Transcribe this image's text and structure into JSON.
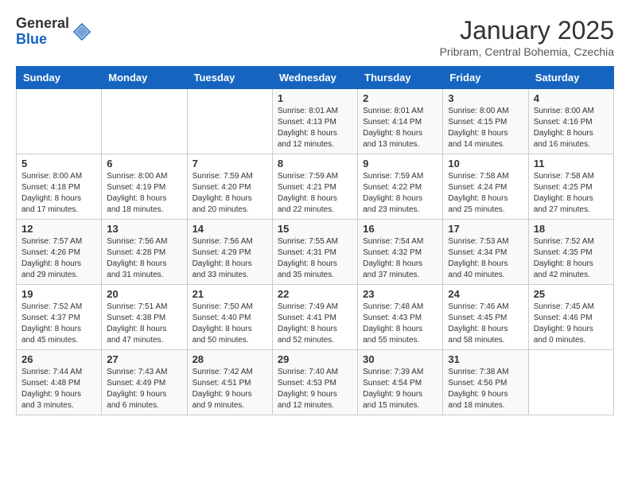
{
  "header": {
    "logo_general": "General",
    "logo_blue": "Blue",
    "month_title": "January 2025",
    "subtitle": "Pribram, Central Bohemia, Czechia"
  },
  "days_of_week": [
    "Sunday",
    "Monday",
    "Tuesday",
    "Wednesday",
    "Thursday",
    "Friday",
    "Saturday"
  ],
  "weeks": [
    [
      {
        "day": "",
        "info": ""
      },
      {
        "day": "",
        "info": ""
      },
      {
        "day": "",
        "info": ""
      },
      {
        "day": "1",
        "info": "Sunrise: 8:01 AM\nSunset: 4:13 PM\nDaylight: 8 hours\nand 12 minutes."
      },
      {
        "day": "2",
        "info": "Sunrise: 8:01 AM\nSunset: 4:14 PM\nDaylight: 8 hours\nand 13 minutes."
      },
      {
        "day": "3",
        "info": "Sunrise: 8:00 AM\nSunset: 4:15 PM\nDaylight: 8 hours\nand 14 minutes."
      },
      {
        "day": "4",
        "info": "Sunrise: 8:00 AM\nSunset: 4:16 PM\nDaylight: 8 hours\nand 16 minutes."
      }
    ],
    [
      {
        "day": "5",
        "info": "Sunrise: 8:00 AM\nSunset: 4:18 PM\nDaylight: 8 hours\nand 17 minutes."
      },
      {
        "day": "6",
        "info": "Sunrise: 8:00 AM\nSunset: 4:19 PM\nDaylight: 8 hours\nand 18 minutes."
      },
      {
        "day": "7",
        "info": "Sunrise: 7:59 AM\nSunset: 4:20 PM\nDaylight: 8 hours\nand 20 minutes."
      },
      {
        "day": "8",
        "info": "Sunrise: 7:59 AM\nSunset: 4:21 PM\nDaylight: 8 hours\nand 22 minutes."
      },
      {
        "day": "9",
        "info": "Sunrise: 7:59 AM\nSunset: 4:22 PM\nDaylight: 8 hours\nand 23 minutes."
      },
      {
        "day": "10",
        "info": "Sunrise: 7:58 AM\nSunset: 4:24 PM\nDaylight: 8 hours\nand 25 minutes."
      },
      {
        "day": "11",
        "info": "Sunrise: 7:58 AM\nSunset: 4:25 PM\nDaylight: 8 hours\nand 27 minutes."
      }
    ],
    [
      {
        "day": "12",
        "info": "Sunrise: 7:57 AM\nSunset: 4:26 PM\nDaylight: 8 hours\nand 29 minutes."
      },
      {
        "day": "13",
        "info": "Sunrise: 7:56 AM\nSunset: 4:28 PM\nDaylight: 8 hours\nand 31 minutes."
      },
      {
        "day": "14",
        "info": "Sunrise: 7:56 AM\nSunset: 4:29 PM\nDaylight: 8 hours\nand 33 minutes."
      },
      {
        "day": "15",
        "info": "Sunrise: 7:55 AM\nSunset: 4:31 PM\nDaylight: 8 hours\nand 35 minutes."
      },
      {
        "day": "16",
        "info": "Sunrise: 7:54 AM\nSunset: 4:32 PM\nDaylight: 8 hours\nand 37 minutes."
      },
      {
        "day": "17",
        "info": "Sunrise: 7:53 AM\nSunset: 4:34 PM\nDaylight: 8 hours\nand 40 minutes."
      },
      {
        "day": "18",
        "info": "Sunrise: 7:52 AM\nSunset: 4:35 PM\nDaylight: 8 hours\nand 42 minutes."
      }
    ],
    [
      {
        "day": "19",
        "info": "Sunrise: 7:52 AM\nSunset: 4:37 PM\nDaylight: 8 hours\nand 45 minutes."
      },
      {
        "day": "20",
        "info": "Sunrise: 7:51 AM\nSunset: 4:38 PM\nDaylight: 8 hours\nand 47 minutes."
      },
      {
        "day": "21",
        "info": "Sunrise: 7:50 AM\nSunset: 4:40 PM\nDaylight: 8 hours\nand 50 minutes."
      },
      {
        "day": "22",
        "info": "Sunrise: 7:49 AM\nSunset: 4:41 PM\nDaylight: 8 hours\nand 52 minutes."
      },
      {
        "day": "23",
        "info": "Sunrise: 7:48 AM\nSunset: 4:43 PM\nDaylight: 8 hours\nand 55 minutes."
      },
      {
        "day": "24",
        "info": "Sunrise: 7:46 AM\nSunset: 4:45 PM\nDaylight: 8 hours\nand 58 minutes."
      },
      {
        "day": "25",
        "info": "Sunrise: 7:45 AM\nSunset: 4:46 PM\nDaylight: 9 hours\nand 0 minutes."
      }
    ],
    [
      {
        "day": "26",
        "info": "Sunrise: 7:44 AM\nSunset: 4:48 PM\nDaylight: 9 hours\nand 3 minutes."
      },
      {
        "day": "27",
        "info": "Sunrise: 7:43 AM\nSunset: 4:49 PM\nDaylight: 9 hours\nand 6 minutes."
      },
      {
        "day": "28",
        "info": "Sunrise: 7:42 AM\nSunset: 4:51 PM\nDaylight: 9 hours\nand 9 minutes."
      },
      {
        "day": "29",
        "info": "Sunrise: 7:40 AM\nSunset: 4:53 PM\nDaylight: 9 hours\nand 12 minutes."
      },
      {
        "day": "30",
        "info": "Sunrise: 7:39 AM\nSunset: 4:54 PM\nDaylight: 9 hours\nand 15 minutes."
      },
      {
        "day": "31",
        "info": "Sunrise: 7:38 AM\nSunset: 4:56 PM\nDaylight: 9 hours\nand 18 minutes."
      },
      {
        "day": "",
        "info": ""
      }
    ]
  ]
}
